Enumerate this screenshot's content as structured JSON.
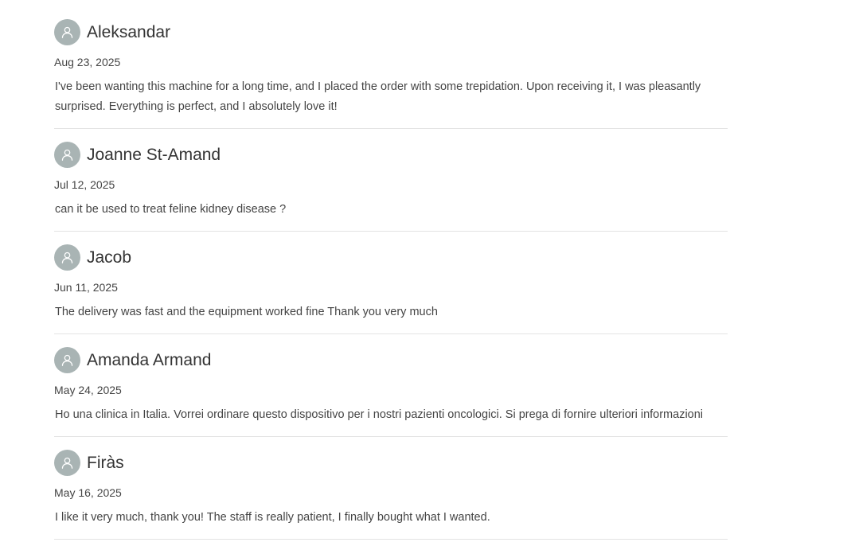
{
  "reviews": [
    {
      "name": "Aleksandar",
      "date": "Aug 23, 2025",
      "text": "I've been wanting this machine for a long time, and I placed the order with some trepidation. Upon receiving it, I was pleasantly surprised. Everything is perfect, and I absolutely love it!",
      "avatar_icon": "user-icon"
    },
    {
      "name": "Joanne St-Amand",
      "date": "Jul 12, 2025",
      "text": "can it be used to treat feline kidney disease ?",
      "avatar_icon": "user-icon"
    },
    {
      "name": "Jacob",
      "date": "Jun 11, 2025",
      "text": "The delivery was fast and the equipment worked fine Thank you very much",
      "avatar_icon": "user-icon"
    },
    {
      "name": "Amanda Armand",
      "date": "May 24, 2025",
      "text": "Ho una clinica in Italia. Vorrei ordinare questo dispositivo per i nostri pazienti oncologici. Si prega di fornire ulteriori informazioni",
      "avatar_icon": "user-icon"
    },
    {
      "name": "Firàs",
      "date": "May 16, 2025",
      "text": "I like it very much, thank you! The staff is really patient, I finally bought what I wanted.",
      "avatar_icon": "user-icon"
    }
  ],
  "colors": {
    "avatar_bg": "#a9b4b4",
    "divider": "#e3e3e3",
    "text": "#444444"
  }
}
